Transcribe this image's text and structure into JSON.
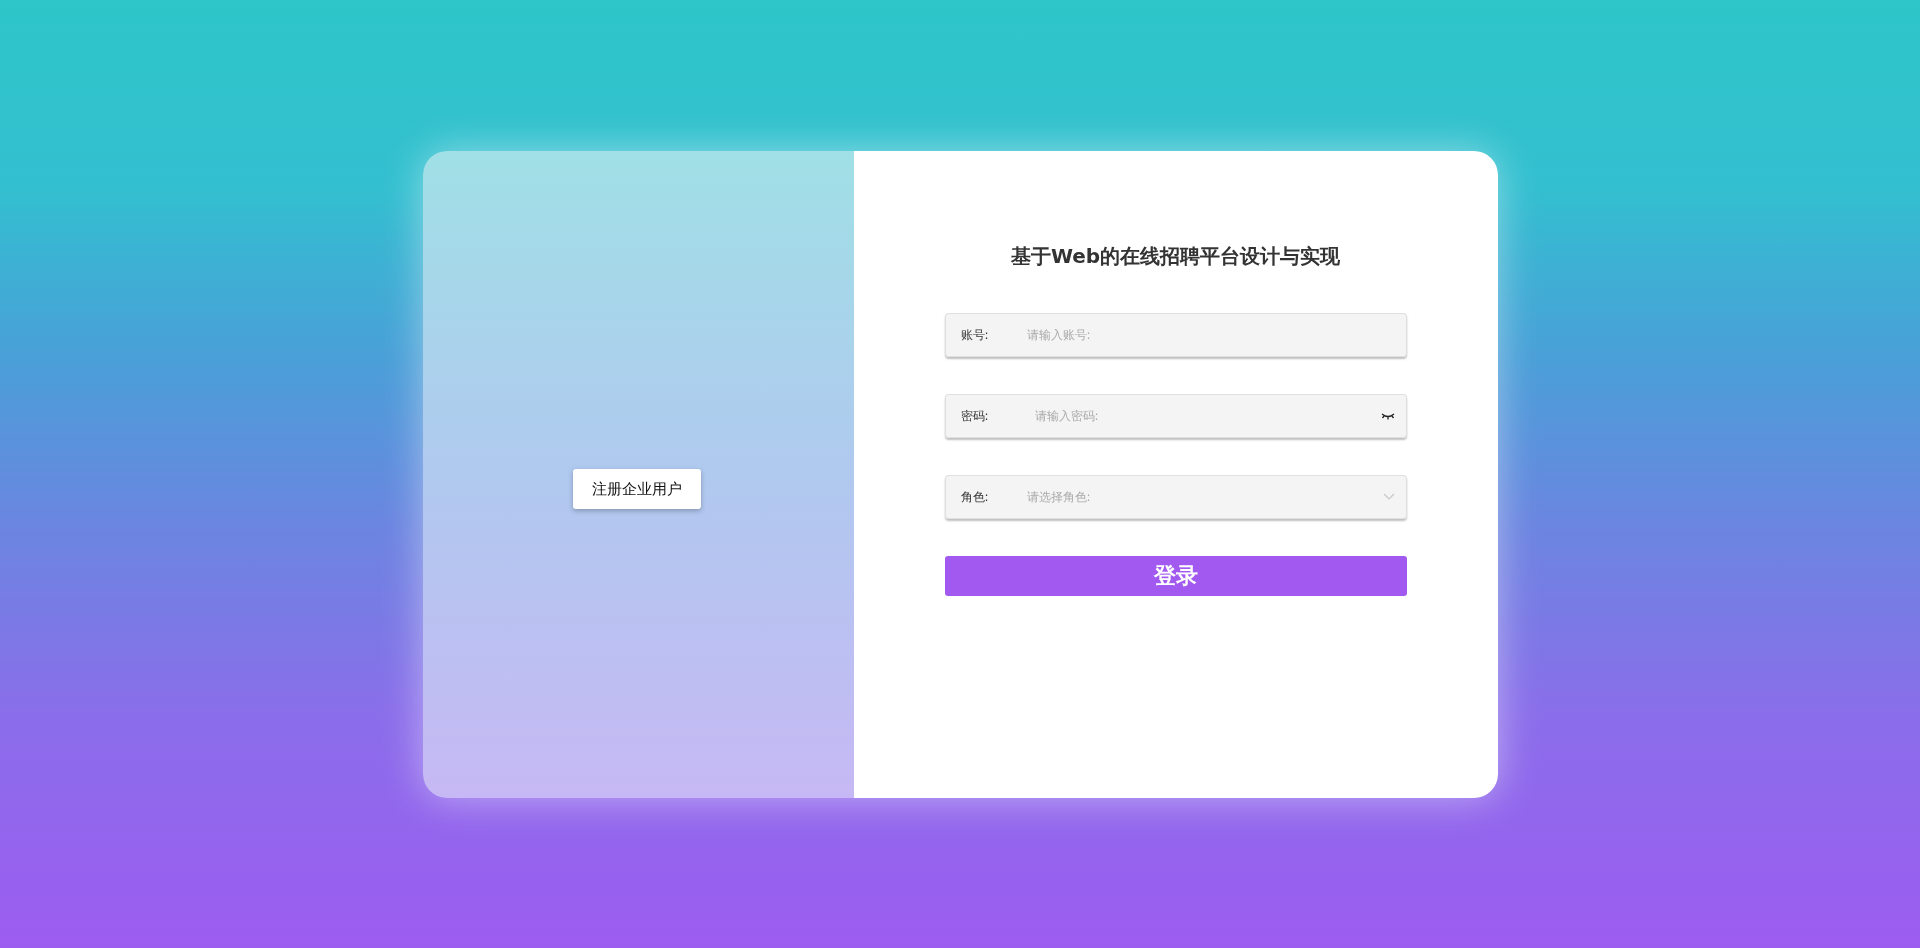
{
  "register_button": {
    "label": "注册企业用户"
  },
  "title": "基于Web的在线招聘平台设计与实现",
  "fields": [
    {
      "kind": "text",
      "label": "账号:",
      "placeholder": "请输入账号:"
    },
    {
      "kind": "password",
      "label": "密码:",
      "placeholder": "请输入密码:"
    },
    {
      "kind": "select",
      "label": "角色:",
      "placeholder": "请选择角色:"
    }
  ],
  "login_button": {
    "label": "登录"
  }
}
